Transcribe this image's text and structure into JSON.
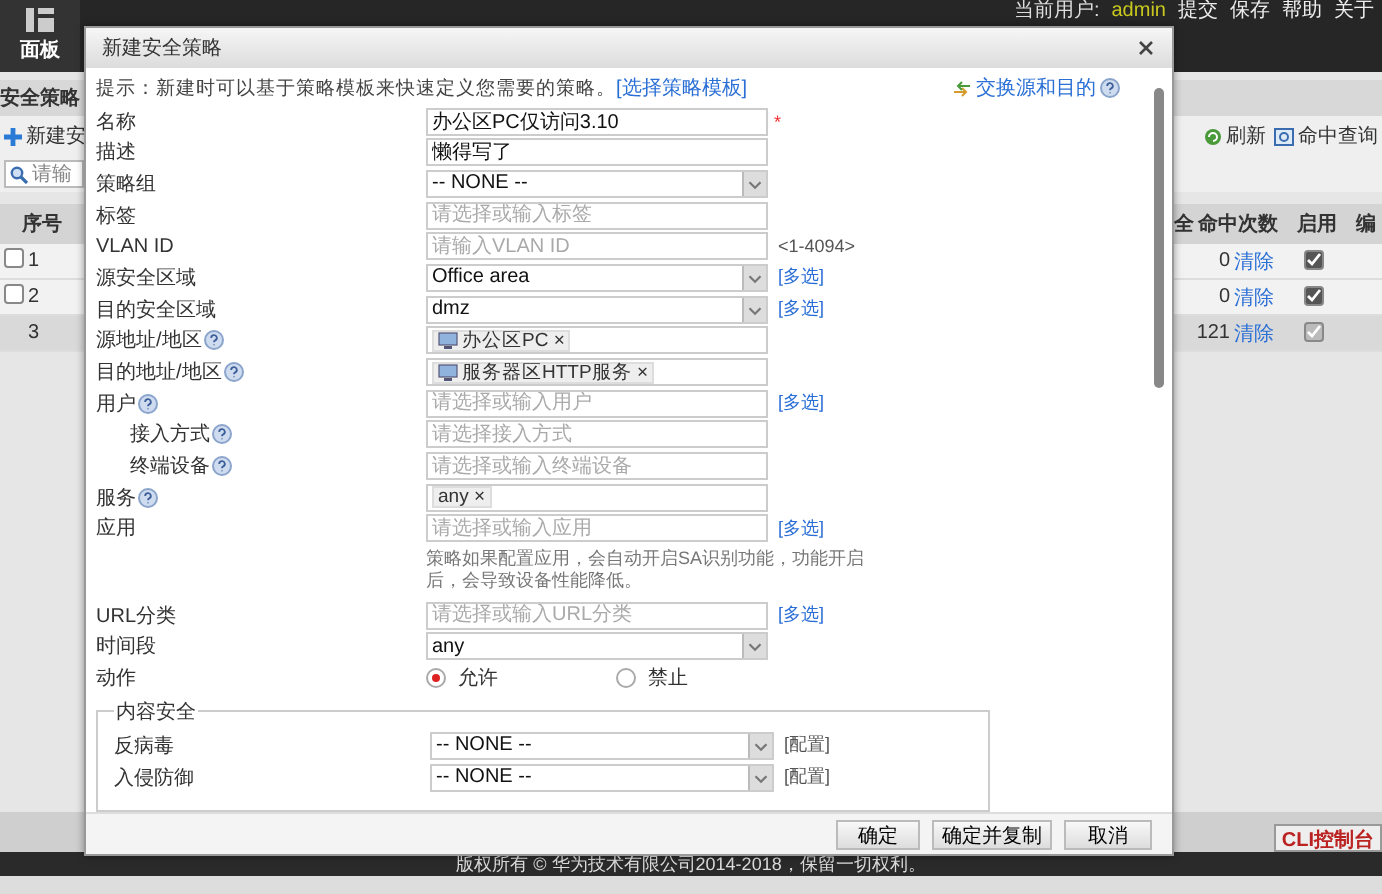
{
  "top_bar": {
    "nav_label": "面板",
    "user_label": "当前用户:",
    "user": "admin",
    "links": [
      "提交",
      "保存",
      "帮助",
      "关于"
    ]
  },
  "left_panel": {
    "title": "安全策略",
    "new_button": "新建安",
    "search_placeholder": "请输",
    "column": "序号",
    "rows": [
      {
        "number": "1",
        "checked": false,
        "default": false
      },
      {
        "number": "2",
        "checked": false,
        "default": false
      },
      {
        "number": "3",
        "default": true
      }
    ]
  },
  "right_panel": {
    "actions": [
      "刷新",
      "命中查询"
    ],
    "columns": [
      "全",
      "命中次数",
      "启用",
      "编"
    ],
    "rows": [
      {
        "hits": "0",
        "clear": "清除",
        "enabled": true,
        "disabled": false
      },
      {
        "hits": "0",
        "clear": "清除",
        "enabled": true,
        "disabled": false
      },
      {
        "hits": "121",
        "clear": "清除",
        "enabled": true,
        "disabled": true
      }
    ]
  },
  "dialog": {
    "title": "新建安全策略",
    "hint": "提示：新建时可以基于策略模板来快速定义您需要的策略。",
    "template_link": "[选择策略模板]",
    "swap_link": "交换源和目的",
    "rows": [
      {
        "kind": "input",
        "label": "名称",
        "value": "办公区PC仅访问3.10",
        "required_mark": "*"
      },
      {
        "kind": "input",
        "label": "描述",
        "value": "懒得写了"
      },
      {
        "kind": "select",
        "label": "策略组",
        "value": "-- NONE --"
      },
      {
        "kind": "input",
        "label": "标签",
        "placeholder": "请选择或输入标签"
      },
      {
        "kind": "input",
        "label": "VLAN ID",
        "placeholder": "请输入VLAN ID",
        "suffix": "<1-4094>"
      },
      {
        "kind": "select",
        "label": "源安全区域",
        "value": "Office area",
        "link": "[多选]"
      },
      {
        "kind": "select",
        "label": "目的安全区域",
        "value": "dmz",
        "link": "[多选]"
      },
      {
        "kind": "tags",
        "label": "源地址/地区",
        "help": true,
        "tags": [
          {
            "text": "办公区PC",
            "icon": true,
            "remove": "×"
          }
        ]
      },
      {
        "kind": "tags",
        "label": "目的地址/地区",
        "help": true,
        "tags": [
          {
            "text": "服务器区HTTP服务",
            "icon": true,
            "remove": "×"
          }
        ]
      },
      {
        "kind": "input",
        "label": "用户",
        "help": true,
        "placeholder": "请选择或输入用户",
        "link": "[多选]",
        "children": [
          {
            "kind": "input",
            "label": "接入方式",
            "help": true,
            "placeholder": "请选择接入方式"
          },
          {
            "kind": "input",
            "label": "终端设备",
            "help": true,
            "placeholder": "请选择或输入终端设备"
          }
        ]
      },
      {
        "kind": "tags",
        "label": "服务",
        "help": true,
        "tags": [
          {
            "text": "any",
            "icon": false,
            "remove": "×"
          }
        ]
      },
      {
        "kind": "input",
        "label": "应用",
        "placeholder": "请选择或输入应用",
        "link": "[多选]"
      },
      {
        "kind": "note",
        "text": "策略如果配置应用，会自动开启SA识别功能，功能开启后，会导致设备性能降低。"
      },
      {
        "kind": "input",
        "label": "URL分类",
        "placeholder": "请选择或输入URL分类",
        "link": "[多选]"
      },
      {
        "kind": "select",
        "label": "时间段",
        "value": "any"
      },
      {
        "kind": "radio",
        "label": "动作",
        "options": [
          {
            "label": "允许",
            "selected": true
          },
          {
            "label": "禁止",
            "selected": false
          }
        ]
      }
    ],
    "content_security": {
      "legend": "内容安全",
      "rows": [
        {
          "label": "反病毒",
          "value": "-- NONE --",
          "link": "[配置]"
        },
        {
          "label": "入侵防御",
          "value": "-- NONE --",
          "link": "[配置]"
        }
      ]
    },
    "buttons": [
      "确定",
      "确定并复制",
      "取消"
    ]
  },
  "footer": {
    "copyright": "版权所有 © 华为技术有限公司2014-2018，保留一切权利。",
    "cli_button": "CLI控制台"
  }
}
